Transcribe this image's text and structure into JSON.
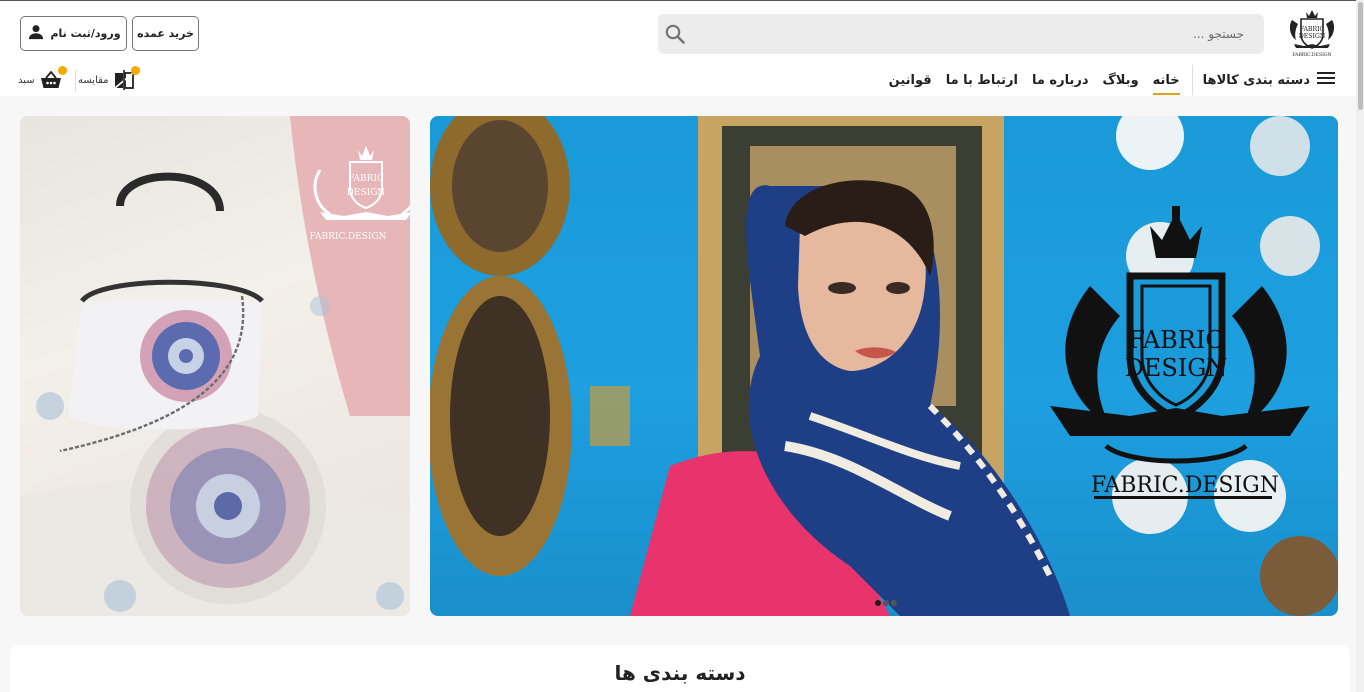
{
  "header": {
    "logo_line1": "FABRIC",
    "logo_line2": "DESIGN",
    "logo_caption": "FABRIC.DESIGN",
    "search_placeholder": "جستجو ...",
    "wholesale_label": "خرید عمده",
    "login_label": "ورود/ثبت نام"
  },
  "nav": {
    "categories_label": "دسته بندی کالاها",
    "links": [
      {
        "label": "خانه",
        "active": true
      },
      {
        "label": "وبلاگ",
        "active": false
      },
      {
        "label": "درباره ما",
        "active": false
      },
      {
        "label": "ارتباط با ما",
        "active": false
      },
      {
        "label": "قوانین",
        "active": false
      }
    ],
    "compare_label": "مقایسه",
    "cart_label": "سبد"
  },
  "banners": {
    "large": {
      "brand_line1": "FABRIC",
      "brand_line2": "DESIGN",
      "brand_caption": "FABRIC.DESIGN"
    },
    "small": {
      "brand_line1": "FABRIC",
      "brand_line2": "DESIGN",
      "brand_caption": "FABRIC.DESIGN"
    }
  },
  "sections": {
    "categories_title": "دسته بندی ها"
  },
  "colors": {
    "accent": "#f2a900",
    "active_underline": "#e0a21c",
    "banner_blue": "#1d9fe0",
    "banner_pink": "#e6b6b8",
    "jacket_pink": "#e8336d"
  },
  "icons": [
    "search-icon",
    "user-icon",
    "menu-icon",
    "compare-icon",
    "cart-icon"
  ]
}
